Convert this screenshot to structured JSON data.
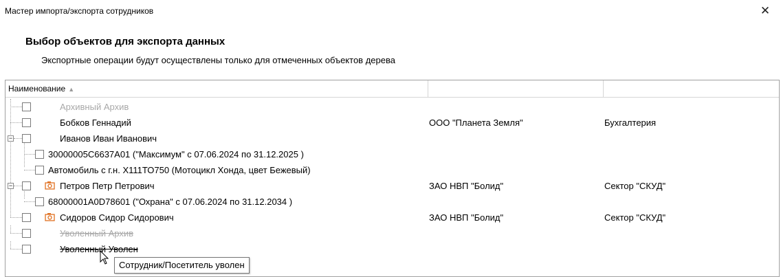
{
  "window": {
    "title": "Мастер импорта/экспорта сотрудников",
    "close_icon": "close-icon"
  },
  "page": {
    "heading": "Выбор объектов для экспорта данных",
    "subheading": "Экспортные операции будут осуществлены только для отмеченных объектов дерева"
  },
  "tree": {
    "columns": [
      {
        "label": "Наименование",
        "sort": "ascending"
      },
      {
        "label": ""
      },
      {
        "label": ""
      }
    ],
    "rows": [
      {
        "name": "Архивный Архив",
        "org": "",
        "dept": "",
        "style": "archived",
        "checked": false
      },
      {
        "name": "Бобков Геннадий",
        "org": "ООО \"Планета Земля\"",
        "dept": "Бухгалтерия",
        "checked": false
      },
      {
        "name": "Иванов Иван Иванович",
        "org": "",
        "dept": "",
        "expanded": true,
        "checked": false
      },
      {
        "name": "30000005C6637A01 (\"Максимум\" с 07.06.2024  по 31.12.2025 )",
        "org": "",
        "dept": "",
        "checked": false
      },
      {
        "name": "Автомобиль с г.н. Х111ТО750 (Мотоцикл Хонда, цвет Бежевый)",
        "org": "",
        "dept": "",
        "checked": false
      },
      {
        "name": "Петров Петр Петрович",
        "org": "ЗАО НВП \"Болид\"",
        "dept": "Сектор \"СКУД\"",
        "expanded": true,
        "photo_icon": "camera-icon",
        "checked": false
      },
      {
        "name": "68000001A0D78601 (\"Охрана\" с 07.06.2024  по 31.12.2034 )",
        "org": "",
        "dept": "",
        "checked": false
      },
      {
        "name": "Сидоров Сидор Сидорович",
        "org": "ЗАО НВП \"Болид\"",
        "dept": "Сектор \"СКУД\"",
        "photo_icon": "camera-icon",
        "checked": false
      },
      {
        "name": "Уволенный Архив",
        "org": "",
        "dept": "",
        "style": "archived-dismissed",
        "checked": false
      },
      {
        "name": "Уволенный Уволен",
        "org": "",
        "dept": "",
        "style": "dismissed",
        "checked": false
      }
    ]
  },
  "tooltip": {
    "text": "Сотрудник/Посетитель уволен"
  },
  "colors": {
    "disabled_text": "#a8a8a8",
    "icon_orange": "#e07020",
    "border": "#a0a0a0"
  }
}
